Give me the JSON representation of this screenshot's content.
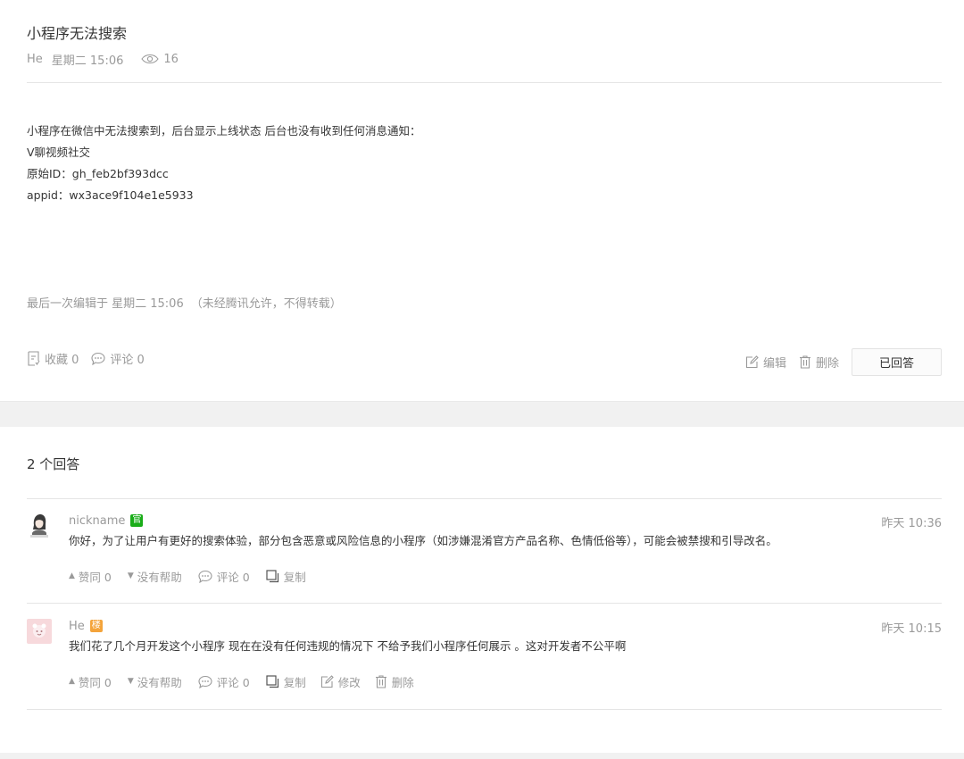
{
  "question": {
    "title": "小程序无法搜索",
    "author": "He",
    "time": "星期二 15:06",
    "views": "16",
    "body": [
      "小程序在微信中无法搜索到，后台显示上线状态 后台也没有收到任何消息通知：",
      "V聊视频社交",
      "原始ID：gh_feb2bf393dcc",
      "appid：wx3ace9f104e1e5933"
    ],
    "edit_note": "最后一次编辑于  星期二 15:06",
    "copyright_note": "（未经腾讯允许，不得转载）",
    "collect_label": "收藏 0",
    "comment_label": "评论 0",
    "edit_label": "编辑",
    "delete_label": "删除",
    "answered_label": "已回答"
  },
  "answers_heading": "2 个回答",
  "answers": [
    {
      "nickname": "nickname",
      "badge": "官",
      "time": "昨天 10:36",
      "text": "你好，为了让用户有更好的搜索体验，部分包含恶意或风险信息的小程序（如涉嫌混淆官方产品名称、色情低俗等），可能会被禁搜和引导改名。",
      "agree_label": "赞同 0",
      "unhelpful_label": "没有帮助",
      "comment_label": "评论 0",
      "copy_label": "复制"
    },
    {
      "nickname": "He",
      "badge": "楼",
      "time": "昨天 10:15",
      "text": "我们花了几个月开发这个小程序  现在在没有任何违规的情况下  不给予我们小程序任何展示  。这对开发者不公平啊",
      "agree_label": "赞同 0",
      "unhelpful_label": "没有帮助",
      "comment_label": "评论 0",
      "copy_label": "复制",
      "modify_label": "修改",
      "delete_label": "删除"
    }
  ],
  "icons": {
    "views": "eye-icon",
    "collect": "bookmark-list-icon",
    "comment": "speech-bubble-icon",
    "edit": "pencil-square-icon",
    "delete": "trash-icon",
    "copy": "copy-icon",
    "agree": "triangle-up-icon",
    "unhelpful": "triangle-down-icon"
  },
  "colors": {
    "official_badge": "#1aad19",
    "owner_badge": "#f4a43b",
    "muted_text": "#9a9a9a",
    "body_text": "#353535"
  }
}
